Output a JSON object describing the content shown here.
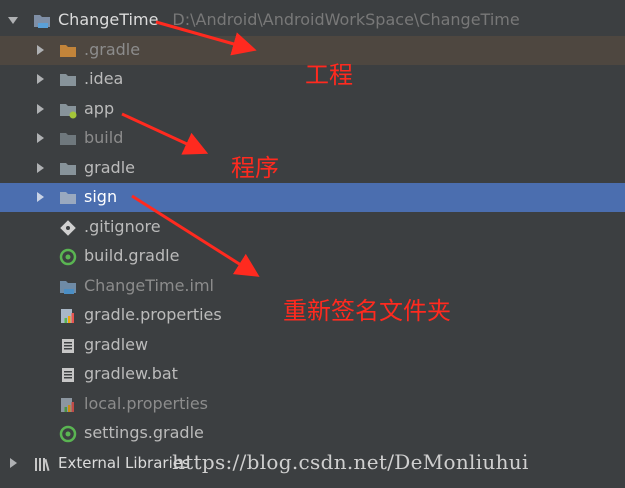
{
  "project": {
    "name": "ChangeTime",
    "path": "D:\\Android\\AndroidWorkSpace\\ChangeTime"
  },
  "tree": {
    "items": [
      {
        "label": ".gradle",
        "icon": "folder-orange-icon"
      },
      {
        "label": ".idea",
        "icon": "folder-icon"
      },
      {
        "label": "app",
        "icon": "module-folder-icon"
      },
      {
        "label": "build",
        "icon": "folder-icon"
      },
      {
        "label": "gradle",
        "icon": "folder-icon"
      },
      {
        "label": "sign",
        "icon": "folder-icon"
      },
      {
        "label": ".gitignore",
        "icon": "git-icon"
      },
      {
        "label": "build.gradle",
        "icon": "gradle-icon"
      },
      {
        "label": "ChangeTime.iml",
        "icon": "iml-icon"
      },
      {
        "label": "gradle.properties",
        "icon": "properties-icon"
      },
      {
        "label": "gradlew",
        "icon": "script-file-icon"
      },
      {
        "label": "gradlew.bat",
        "icon": "script-file-icon"
      },
      {
        "label": "local.properties",
        "icon": "properties-icon"
      },
      {
        "label": "settings.gradle",
        "icon": "gradle-icon"
      }
    ],
    "external_libraries": "External Libraries"
  },
  "annotations": {
    "project_note": "工程",
    "program_note": "程序",
    "resign_note": "重新签名文件夹"
  },
  "watermark": "https://blog.csdn.net/DeMonliuhui",
  "colors": {
    "background": "#3c3f41",
    "selection": "#4b6eaf",
    "annotation": "#ff2a1f"
  }
}
